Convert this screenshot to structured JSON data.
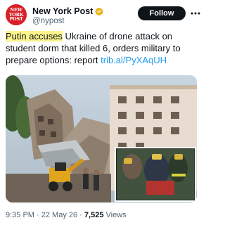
{
  "account": {
    "display_name": "New York Post",
    "handle": "@nypost",
    "avatar_text": [
      "NEW",
      "YORK",
      "POST"
    ]
  },
  "actions": {
    "follow_label": "Follow"
  },
  "tweet": {
    "highlighted": "Putin accuses",
    "text_rest": " Ukraine of drone attack on student dorm that killed 6, orders military to prepare options: report ",
    "link": "trib.al/PyXAqUH"
  },
  "footer": {
    "time": "9:35 PM",
    "separator1": " · ",
    "date": "22 May 26",
    "separator2": " · ",
    "views_count": "7,525",
    "views_label": " Views"
  },
  "colors": {
    "accent": "#1d9bf0",
    "avatar_red": "#d81f26",
    "highlight": "#fcf48c",
    "verified_gold": "#e8b51a"
  },
  "icons": [
    "verified-badge-icon",
    "more-options-icon"
  ]
}
